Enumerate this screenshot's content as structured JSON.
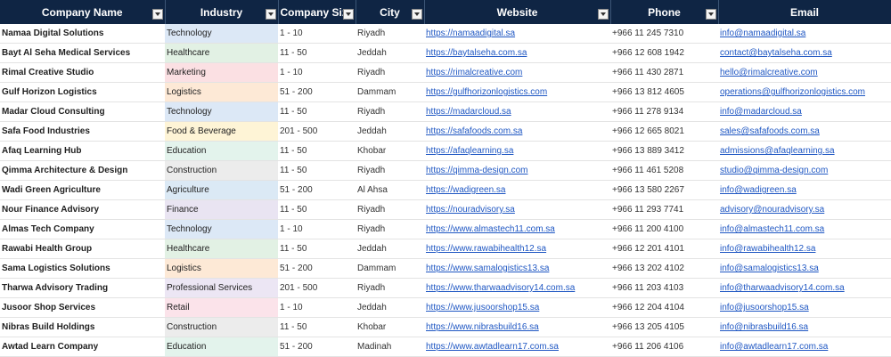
{
  "columns": [
    {
      "key": "company",
      "label": "Company Name"
    },
    {
      "key": "industry",
      "label": "Industry"
    },
    {
      "key": "size",
      "label": "Company Size"
    },
    {
      "key": "city",
      "label": "City"
    },
    {
      "key": "website",
      "label": "Website"
    },
    {
      "key": "phone",
      "label": "Phone"
    },
    {
      "key": "email",
      "label": "Email"
    }
  ],
  "industry_colors": {
    "Technology": "#dce8f6",
    "Healthcare": "#e2f1e4",
    "Marketing": "#fbe0e3",
    "Logistics": "#fde9d6",
    "Food & Beverage": "#fef4d6",
    "Education": "#e3f3ec",
    "Construction": "#ececec",
    "Agriculture": "#dbe9f5",
    "Finance": "#e9e4f2",
    "Professional Services": "#ece6f4",
    "Retail": "#fbe3ea"
  },
  "rows": [
    {
      "company": "Namaa Digital Solutions",
      "industry": "Technology",
      "size": "1 - 10",
      "city": "Riyadh",
      "website": "https://namaadigital.sa",
      "phone": "+966 11 245 7310",
      "email": "info@namaadigital.sa"
    },
    {
      "company": "Bayt Al Seha Medical Services",
      "industry": "Healthcare",
      "size": "11 - 50",
      "city": "Jeddah",
      "website": "https://baytalseha.com.sa",
      "phone": "+966 12 608 1942",
      "email": "contact@baytalseha.com.sa"
    },
    {
      "company": "Rimal Creative Studio",
      "industry": "Marketing",
      "size": "1 - 10",
      "city": "Riyadh",
      "website": "https://rimalcreative.com",
      "phone": "+966 11 430 2871",
      "email": "hello@rimalcreative.com"
    },
    {
      "company": "Gulf Horizon Logistics",
      "industry": "Logistics",
      "size": "51 - 200",
      "city": "Dammam",
      "website": "https://gulfhorizonlogistics.com",
      "phone": "+966 13 812 4605",
      "email": "operations@gulfhorizonlogistics.com"
    },
    {
      "company": "Madar Cloud Consulting",
      "industry": "Technology",
      "size": "11 - 50",
      "city": "Riyadh",
      "website": "https://madarcloud.sa",
      "phone": "+966 11 278 9134",
      "email": "info@madarcloud.sa"
    },
    {
      "company": "Safa Food Industries",
      "industry": "Food & Beverage",
      "size": "201 - 500",
      "city": "Jeddah",
      "website": "https://safafoods.com.sa",
      "phone": "+966 12 665 8021",
      "email": "sales@safafoods.com.sa"
    },
    {
      "company": "Afaq Learning Hub",
      "industry": "Education",
      "size": "11 - 50",
      "city": "Khobar",
      "website": "https://afaqlearning.sa",
      "phone": "+966 13 889 3412",
      "email": "admissions@afaqlearning.sa"
    },
    {
      "company": "Qimma Architecture & Design",
      "industry": "Construction",
      "size": "11 - 50",
      "city": "Riyadh",
      "website": "https://qimma-design.com",
      "phone": "+966 11 461 5208",
      "email": "studio@qimma-design.com"
    },
    {
      "company": "Wadi Green Agriculture",
      "industry": "Agriculture",
      "size": "51 - 200",
      "city": "Al Ahsa",
      "website": "https://wadigreen.sa",
      "phone": "+966 13 580 2267",
      "email": "info@wadigreen.sa"
    },
    {
      "company": "Nour Finance Advisory",
      "industry": "Finance",
      "size": "11 - 50",
      "city": "Riyadh",
      "website": "https://nouradvisory.sa",
      "phone": "+966 11 293 7741",
      "email": "advisory@nouradvisory.sa"
    },
    {
      "company": "Almas Tech Company",
      "industry": "Technology",
      "size": "1 - 10",
      "city": "Riyadh",
      "website": "https://www.almastech11.com.sa",
      "phone": "+966 11 200 4100",
      "email": "info@almastech11.com.sa"
    },
    {
      "company": "Rawabi Health Group",
      "industry": "Healthcare",
      "size": "11 - 50",
      "city": "Jeddah",
      "website": "https://www.rawabihealth12.sa",
      "phone": "+966 12 201 4101",
      "email": "info@rawabihealth12.sa"
    },
    {
      "company": "Sama Logistics Solutions",
      "industry": "Logistics",
      "size": "51 - 200",
      "city": "Dammam",
      "website": "https://www.samalogistics13.sa",
      "phone": "+966 13 202 4102",
      "email": "info@samalogistics13.sa"
    },
    {
      "company": "Tharwa Advisory Trading",
      "industry": "Professional Services",
      "size": "201 - 500",
      "city": "Riyadh",
      "website": "https://www.tharwaadvisory14.com.sa",
      "phone": "+966 11 203 4103",
      "email": "info@tharwaadvisory14.com.sa"
    },
    {
      "company": "Jusoor Shop Services",
      "industry": "Retail",
      "size": "1 - 10",
      "city": "Jeddah",
      "website": "https://www.jusoorshop15.sa",
      "phone": "+966 12 204 4104",
      "email": "info@jusoorshop15.sa"
    },
    {
      "company": "Nibras Build Holdings",
      "industry": "Construction",
      "size": "11 - 50",
      "city": "Khobar",
      "website": "https://www.nibrasbuild16.sa",
      "phone": "+966 13 205 4105",
      "email": "info@nibrasbuild16.sa"
    },
    {
      "company": "Awtad Learn Company",
      "industry": "Education",
      "size": "51 - 200",
      "city": "Madinah",
      "website": "https://www.awtadlearn17.com.sa",
      "phone": "+966 11 206 4106",
      "email": "info@awtadlearn17.com.sa"
    }
  ]
}
